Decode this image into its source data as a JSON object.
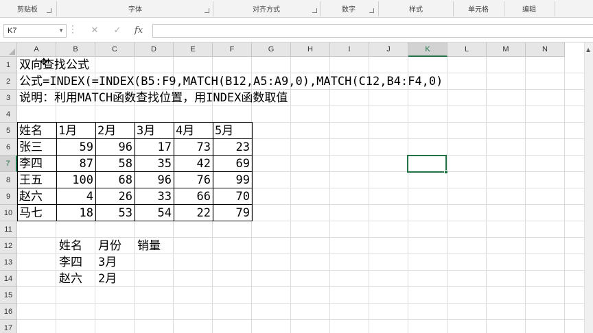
{
  "ribbon": {
    "groups": [
      {
        "label": "剪贴板"
      },
      {
        "label": "字体"
      },
      {
        "label": "对齐方式"
      },
      {
        "label": "数字"
      },
      {
        "label": "样式"
      },
      {
        "label": "单元格"
      },
      {
        "label": "编辑"
      }
    ]
  },
  "formula_bar": {
    "name_box": "K7",
    "cancel_icon": "✕",
    "enter_icon": "✓",
    "fx_label": "fx",
    "formula": ""
  },
  "sheet": {
    "columns": [
      "A",
      "B",
      "C",
      "D",
      "E",
      "F",
      "G",
      "H",
      "I",
      "J",
      "K",
      "L",
      "M",
      "N"
    ],
    "rows": [
      "1",
      "2",
      "3",
      "4",
      "5",
      "6",
      "7",
      "8",
      "9",
      "10",
      "11",
      "12",
      "13",
      "14",
      "15",
      "16",
      "17"
    ],
    "selected_cell": "K7",
    "title": "双向查找公式",
    "formula_text": "公式=INDEX(=INDEX(B5:F9,MATCH(B12,A5:A9,0),MATCH(C12,B4:F4,0)",
    "note_text": "说明：利用MATCH函数查找位置，用INDEX函数取值",
    "table": {
      "header": [
        "姓名",
        "1月",
        "2月",
        "3月",
        "4月",
        "5月"
      ],
      "rows": [
        {
          "name": "张三",
          "values": [
            "59",
            "96",
            "17",
            "73",
            "23"
          ]
        },
        {
          "name": "李四",
          "values": [
            "87",
            "58",
            "35",
            "42",
            "69"
          ]
        },
        {
          "name": "王五",
          "values": [
            "100",
            "68",
            "96",
            "76",
            "99"
          ]
        },
        {
          "name": "赵六",
          "values": [
            "4",
            "26",
            "33",
            "66",
            "70"
          ]
        },
        {
          "name": "马七",
          "values": [
            "18",
            "53",
            "54",
            "22",
            "79"
          ]
        }
      ]
    },
    "lookup": {
      "header": [
        "姓名",
        "月份",
        "销量"
      ],
      "rows": [
        [
          "李四",
          "3月"
        ],
        [
          "赵六",
          "2月"
        ]
      ]
    }
  },
  "colors": {
    "accent": "#217346",
    "grid": "#dadcdd"
  }
}
